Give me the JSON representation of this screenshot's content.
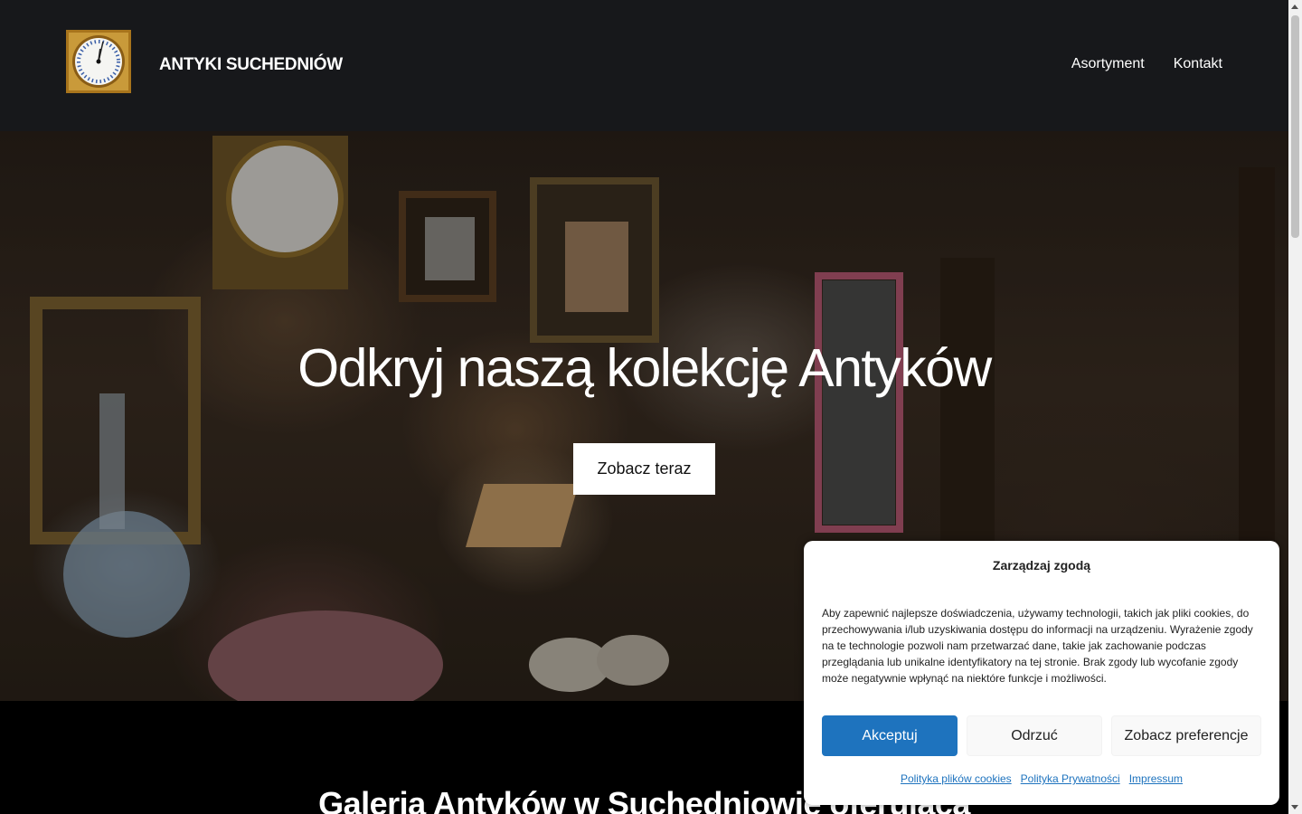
{
  "header": {
    "brand": "ANTYKI SUCHEDNIÓW",
    "logo_icon": "clock-logo-icon",
    "nav": [
      "Asortyment",
      "Kontakt"
    ]
  },
  "hero": {
    "title": "Odkryj naszą kolekcję Antyków",
    "cta": "Zobacz teraz"
  },
  "section": {
    "title": "Galeria Antyków w Suchedniowie oferująca"
  },
  "cookie": {
    "title": "Zarządzaj zgodą",
    "text": "Aby zapewnić najlepsze doświadczenia, używamy technologii, takich jak pliki cookies, do przechowywania i/lub uzyskiwania dostępu do informacji na urządzeniu. Wyrażenie zgody na te technologie pozwoli nam przetwarzać dane, takie jak zachowanie podczas przeglądania lub unikalne identyfikatory na tej stronie. Brak zgody lub wycofanie zgody może negatywnie wpłynąć na niektóre funkcje i możliwości.",
    "accept": "Akceptuj",
    "deny": "Odrzuć",
    "preferences": "Zobacz preferencje",
    "links": [
      "Polityka plików cookies",
      "Polityka Prywatności",
      "Impressum"
    ]
  },
  "colors": {
    "header_bg": "#17181b",
    "accent": "#1e73be"
  }
}
